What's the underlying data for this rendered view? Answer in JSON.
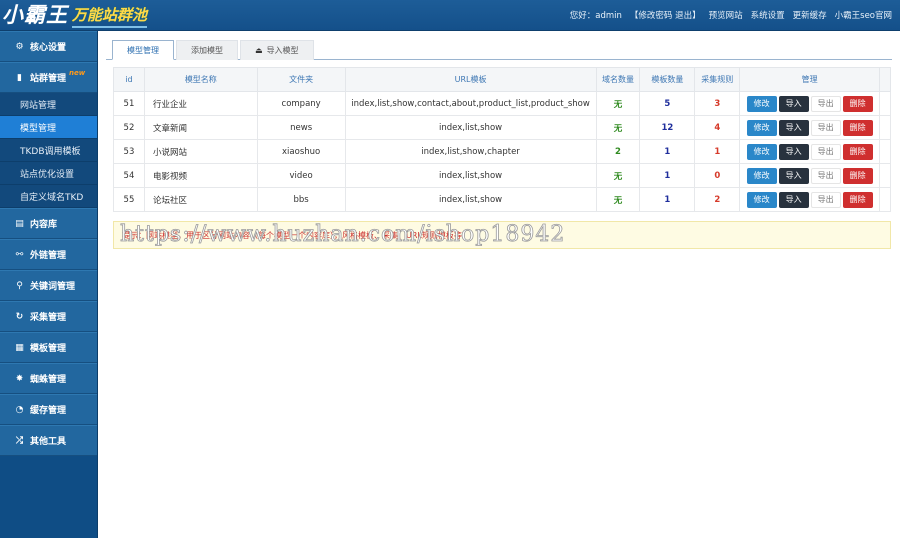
{
  "header": {
    "logo_main": "小霸王",
    "logo_sub": "万能站群池",
    "greeting": "您好：admin",
    "account_links": "【修改密码 退出】",
    "nav": [
      "预览网站",
      "系统设置",
      "更新缓存",
      "小霸王seo官网"
    ]
  },
  "sidebar": {
    "groups": [
      {
        "label": "核心设置",
        "icon": "gear-icon"
      },
      {
        "label": "站群管理",
        "icon": "user-icon",
        "badge": "new"
      },
      {
        "label": "内容库",
        "icon": "document-icon"
      },
      {
        "label": "外链管理",
        "icon": "link-icon"
      },
      {
        "label": "关键词管理",
        "icon": "key-icon"
      },
      {
        "label": "采集管理",
        "icon": "refresh-icon"
      },
      {
        "label": "模板管理",
        "icon": "windows-icon"
      },
      {
        "label": "蜘蛛管理",
        "icon": "spider-icon"
      },
      {
        "label": "缓存管理",
        "icon": "cache-icon"
      },
      {
        "label": "其他工具",
        "icon": "shuffle-icon"
      }
    ],
    "sub_items": [
      {
        "label": "网站管理",
        "active": false
      },
      {
        "label": "模型管理",
        "active": true
      },
      {
        "label": "TKDB调用模板",
        "active": false
      },
      {
        "label": "站点优化设置",
        "active": false
      },
      {
        "label": "自定义域名TKD",
        "active": false
      }
    ]
  },
  "tabs": [
    {
      "label": "模型管理",
      "active": true
    },
    {
      "label": "添加模型",
      "active": false
    },
    {
      "label": "导入模型",
      "active": false,
      "icon": "upload-icon"
    }
  ],
  "table": {
    "columns": [
      "id",
      "模型名称",
      "文件夹",
      "URL模板",
      "域名数量",
      "模板数量",
      "采集规则",
      "管理"
    ],
    "rows": [
      {
        "id": "51",
        "name": "行业企业",
        "folder": "company",
        "url": "index,list,show,contact,about,product_list,product_show",
        "domains": "无",
        "templates": "5",
        "rules": "3"
      },
      {
        "id": "52",
        "name": "文章新闻",
        "folder": "news",
        "url": "index,list,show",
        "domains": "无",
        "templates": "12",
        "rules": "4"
      },
      {
        "id": "53",
        "name": "小说网站",
        "folder": "xiaoshuo",
        "url": "index,list,show,chapter",
        "domains": "2",
        "templates": "1",
        "rules": "1"
      },
      {
        "id": "54",
        "name": "电影视频",
        "folder": "video",
        "url": "index,list,show",
        "domains": "无",
        "templates": "1",
        "rules": "0"
      },
      {
        "id": "55",
        "name": "论坛社区",
        "folder": "bbs",
        "url": "index,list,show",
        "domains": "无",
        "templates": "1",
        "rules": "2"
      }
    ],
    "actions": {
      "edit": "修改",
      "import": "导入",
      "export": "导出",
      "delete": "删除"
    }
  },
  "tip": "提示：网站模型，用于区分网站内容（每个模型一个内容库），风格模板、采集、URL规则模板等",
  "watermark": "https://www.huzhan.com/ishop18942"
}
